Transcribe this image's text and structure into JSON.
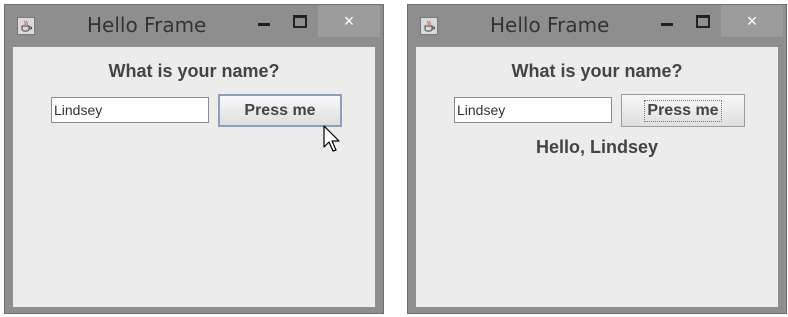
{
  "left_window": {
    "title": "Hello Frame",
    "prompt": "What is your name?",
    "name_input_value": "Lindsey",
    "button_label": "Press me"
  },
  "right_window": {
    "title": "Hello Frame",
    "prompt": "What is your name?",
    "name_input_value": "Lindsey",
    "button_label": "Press me",
    "greeting": "Hello, Lindsey"
  },
  "window_controls": {
    "close_glyph": "×"
  },
  "icons": {
    "app": "java-cup-icon",
    "minimize": "minimize-icon",
    "maximize": "maximize-icon",
    "close": "close-icon",
    "pointer": "mouse-pointer-icon"
  }
}
